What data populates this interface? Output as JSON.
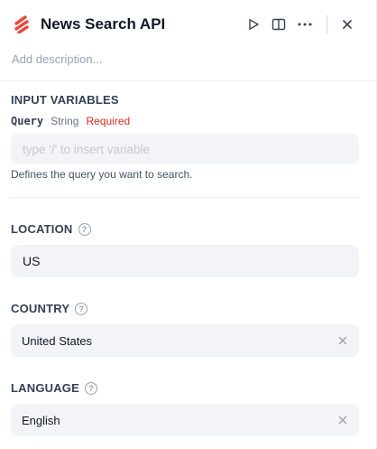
{
  "header": {
    "title": "News Search API",
    "description_placeholder": "Add description...",
    "logo_color": "#f04438"
  },
  "input_variables": {
    "section_title": "INPUT VARIABLES",
    "query": {
      "name": "Query",
      "type": "String",
      "required_label": "Required",
      "placeholder": "type '/' to insert variable",
      "hint": "Defines the query you want to search."
    }
  },
  "location": {
    "label": "LOCATION",
    "value": "US"
  },
  "country": {
    "label": "COUNTRY",
    "value": "United States"
  },
  "language": {
    "label": "LANGUAGE",
    "value": "English"
  },
  "icons": {
    "run": "play-icon",
    "docs": "book-open-icon",
    "more": "more-horizontal-icon",
    "close": "close-icon",
    "help": "question-circle-icon",
    "clear": "clear-icon"
  }
}
